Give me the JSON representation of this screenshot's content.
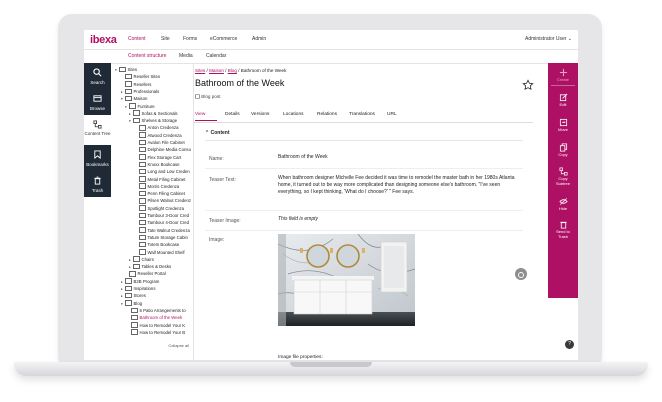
{
  "brand": {
    "logo_text": "ibexa",
    "accent": "#ae1164",
    "dark": "#1f2a36"
  },
  "topnav": {
    "items": [
      "Content",
      "Site",
      "Forms",
      "eCommerce",
      "Admin"
    ],
    "user": "Administrator User ⌄"
  },
  "subnav": {
    "items": [
      "Content structure",
      "Media",
      "Calendar"
    ]
  },
  "leftbar": {
    "items": [
      {
        "label": "Search",
        "icon": "search-icon"
      },
      {
        "label": "Browse",
        "icon": "browse-icon"
      },
      {
        "label": "Content Tree",
        "icon": "tree-icon"
      },
      {
        "label": "Bookmarks",
        "icon": "bookmark-icon"
      },
      {
        "label": "Trash",
        "icon": "trash-icon"
      }
    ]
  },
  "tree": {
    "rows": [
      {
        "label": "Sites",
        "toggle": "▾"
      },
      {
        "label": "Reseller Sites",
        "toggle": ""
      },
      {
        "label": "Resellers",
        "toggle": ""
      },
      {
        "label": "Professionals",
        "toggle": "▸"
      },
      {
        "label": "Maison",
        "toggle": "▾"
      },
      {
        "label": "Furniture",
        "toggle": "▾"
      },
      {
        "label": "Sofas & Sectionals",
        "toggle": "▸"
      },
      {
        "label": "Shelves & Storage",
        "toggle": "▾"
      },
      {
        "label": "Anton Credenza",
        "toggle": ""
      },
      {
        "label": "Atwood Credenza",
        "toggle": ""
      },
      {
        "label": "Avalon File Cabinet",
        "toggle": ""
      },
      {
        "label": "Delphine Media Conso",
        "toggle": ""
      },
      {
        "label": "Flex Storage Cart",
        "toggle": ""
      },
      {
        "label": "Knoxx Bookcase",
        "toggle": ""
      },
      {
        "label": "Long and Low Creden",
        "toggle": ""
      },
      {
        "label": "Metal Filing Cabinet",
        "toggle": ""
      },
      {
        "label": "Morris Credenza",
        "toggle": ""
      },
      {
        "label": "Penn Filing Cabinet",
        "toggle": ""
      },
      {
        "label": "Pilsen Walnut Credenz",
        "toggle": ""
      },
      {
        "label": "Spotlight Credenza",
        "toggle": ""
      },
      {
        "label": "Tambour 3-Door Cred",
        "toggle": ""
      },
      {
        "label": "Tambour 4-Door Cred",
        "toggle": ""
      },
      {
        "label": "Tate Walnut Credenza",
        "toggle": ""
      },
      {
        "label": "Tatum Storage Cabin",
        "toggle": ""
      },
      {
        "label": "Totem Bookcase",
        "toggle": ""
      },
      {
        "label": "Wall Mounted Shelf",
        "toggle": ""
      },
      {
        "label": "Chairs",
        "toggle": "▸"
      },
      {
        "label": "Tables & Desks",
        "toggle": "▸"
      },
      {
        "label": "Reseller Portal",
        "toggle": ""
      },
      {
        "label": "B2B Program",
        "toggle": "▸"
      },
      {
        "label": "Inspirations",
        "toggle": "▸"
      },
      {
        "label": "Stores",
        "toggle": "▸"
      },
      {
        "label": "Blog",
        "toggle": "▾"
      },
      {
        "label": "5 Patio Arrangements to",
        "toggle": ""
      },
      {
        "label": "Bathroom of the Week",
        "toggle": "",
        "selected": true
      },
      {
        "label": "How to Remodel Your K",
        "toggle": ""
      },
      {
        "label": "How to Remodel Your B",
        "toggle": ""
      }
    ],
    "collapse_all": "Collapse all"
  },
  "main": {
    "breadcrumb": {
      "links": [
        "Sites",
        "Maison",
        "Blog"
      ],
      "separator": " / ",
      "current": "Bathroom of the Week"
    },
    "title": "Bathroom of the Week",
    "content_type": "Blog post",
    "tabs": [
      "View",
      "Details",
      "Versions",
      "Locations",
      "Relations",
      "Translations",
      "URL"
    ],
    "section_title": "Content",
    "fields": [
      {
        "label": "Name:",
        "value": "Bathroom of the Week"
      },
      {
        "label": "Teaser Text:",
        "value": "When bathroom designer Michelle Fee decided it was time to remodel the master bath in her 1980s Atlanta home, it turned out to be way more complicated than designing someone else's bathroom. \"I've seen everything, so I kept thinking, 'What do I choose?' \" Fee says."
      },
      {
        "label": "Teaser Image:",
        "value": "This field is empty"
      },
      {
        "label": "Image:",
        "value": ""
      }
    ],
    "image_props_label": "Image file properties:"
  },
  "rightbar": {
    "items": [
      {
        "label": "Create",
        "icon": "create-icon",
        "disabled": true
      },
      {
        "label": "Edit",
        "icon": "edit-icon"
      },
      {
        "label": "Move",
        "icon": "move-icon"
      },
      {
        "label": "Copy",
        "icon": "copy-icon"
      },
      {
        "label": "Copy Subtree",
        "icon": "copy-subtree-icon"
      },
      {
        "label": "Hide",
        "icon": "hide-icon"
      },
      {
        "label": "Send to Trash",
        "icon": "send-to-trash-icon"
      }
    ]
  },
  "help": "?"
}
